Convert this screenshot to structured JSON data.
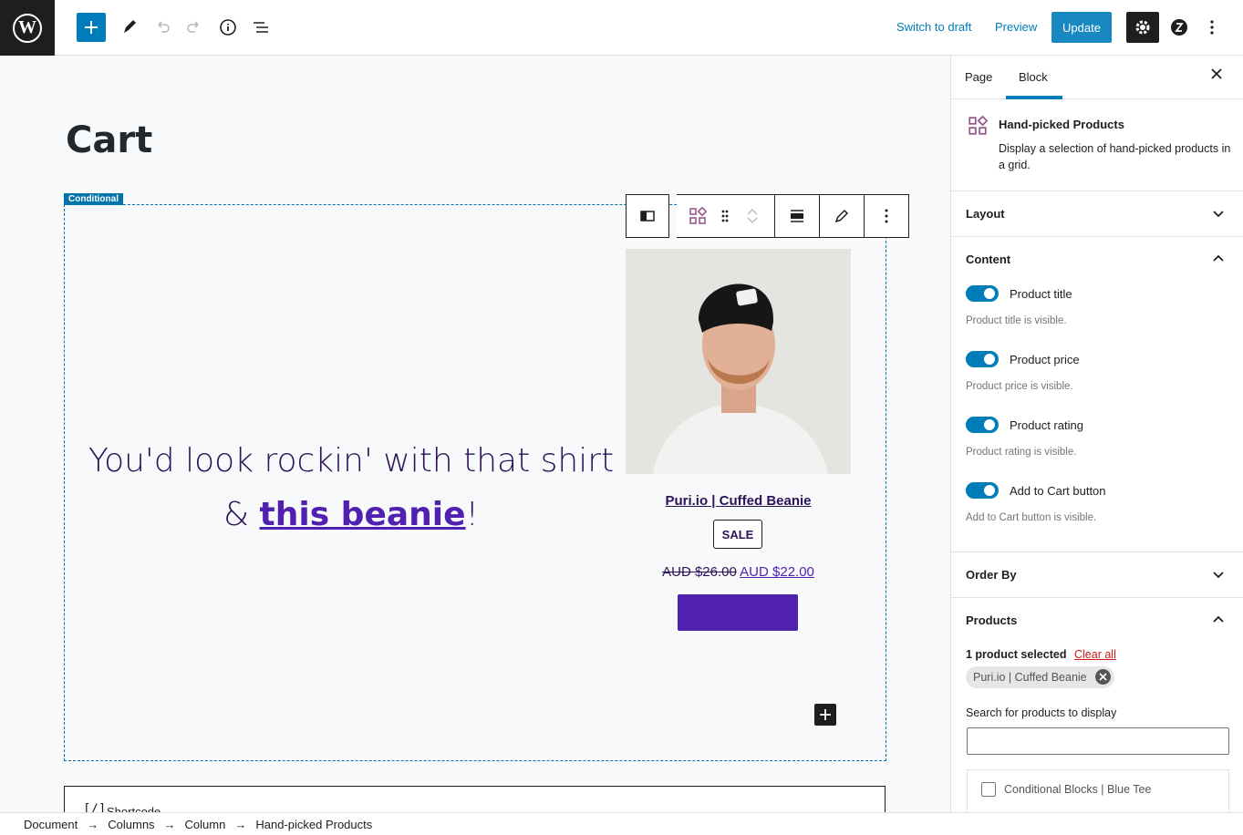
{
  "topbar": {
    "wp_logo": "W",
    "switch_to_draft": "Switch to draft",
    "preview": "Preview",
    "update": "Update"
  },
  "editor": {
    "page_title": "Cart",
    "conditional_label": "Conditional",
    "headline_before": "You'd look rockin' with that shirt & ",
    "headline_link": "this beanie",
    "headline_after": "!",
    "product": {
      "title": "Puri.io | Cuffed Beanie",
      "badge": "SALE",
      "old_price": "AUD $26.00",
      "new_price": "AUD $22.00"
    },
    "shortcode_icon": "[/]",
    "shortcode_label": "Shortcode"
  },
  "breadcrumb": [
    "Document",
    "Columns",
    "Column",
    "Hand-picked Products"
  ],
  "breadcrumb_sep": "→",
  "sidebar": {
    "tab_page": "Page",
    "tab_block": "Block",
    "block_name": "Hand-picked Products",
    "block_desc": "Display a selection of hand-picked products in a grid.",
    "panels": {
      "layout": "Layout",
      "content": "Content",
      "order_by": "Order By",
      "products": "Products"
    },
    "toggles": [
      {
        "label": "Product title",
        "help": "Product title is visible.",
        "on": true
      },
      {
        "label": "Product price",
        "help": "Product price is visible.",
        "on": true
      },
      {
        "label": "Product rating",
        "help": "Product rating is visible.",
        "on": true
      },
      {
        "label": "Add to Cart button",
        "help": "Add to Cart button is visible.",
        "on": true
      }
    ],
    "selected_count": "1 product selected",
    "clear_all": "Clear all",
    "chip": "Puri.io | Cuffed Beanie",
    "search_label": "Search for products to display",
    "search_value": "",
    "result_item": "Conditional Blocks | Blue Tee"
  },
  "colors": {
    "accent": "#007cba",
    "heading_text": "#2c1259",
    "link_purple": "#5021b0",
    "danger": "#cc1818"
  }
}
